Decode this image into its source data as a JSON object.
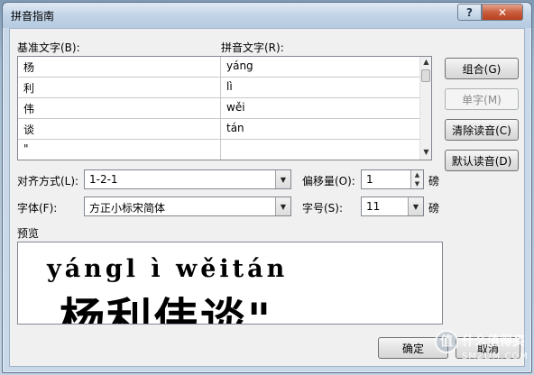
{
  "window": {
    "title": "拼音指南",
    "help_glyph": "?",
    "close_glyph": "✕"
  },
  "labels": {
    "base_text": "基准文字(B):",
    "pinyin_text": "拼音文字(R):",
    "alignment": "对齐方式(L):",
    "offset": "偏移量(O):",
    "offset_unit": "磅",
    "font": "字体(F):",
    "size": "字号(S):",
    "size_unit": "磅",
    "preview": "预览"
  },
  "rows": [
    {
      "base": "杨",
      "pinyin": "yáng"
    },
    {
      "base": "利",
      "pinyin": "lì"
    },
    {
      "base": "伟",
      "pinyin": "wěi"
    },
    {
      "base": "谈",
      "pinyin": "tán"
    },
    {
      "base": "\"",
      "pinyin": ""
    }
  ],
  "buttons": {
    "group": "组合(G)",
    "single": "单字(M)",
    "clear": "清除读音(C)",
    "default": "默认读音(D)",
    "ok": "确定",
    "cancel": "取消"
  },
  "fields": {
    "alignment_value": "1-2-1",
    "offset_value": "1",
    "font_value": "方正小标宋简体",
    "size_value": "11"
  },
  "preview": {
    "pinyin_line": "yángl ì wěitán",
    "hanzi_line": "杨利伟谈\""
  },
  "watermark": {
    "badge": "值",
    "line1": "什么值得买",
    "line2": "SMZDM.COM"
  },
  "colors": {
    "titlebar": "#c2d4e7",
    "close_button": "#c95f3f",
    "dialog_face": "#f0f0f0"
  }
}
